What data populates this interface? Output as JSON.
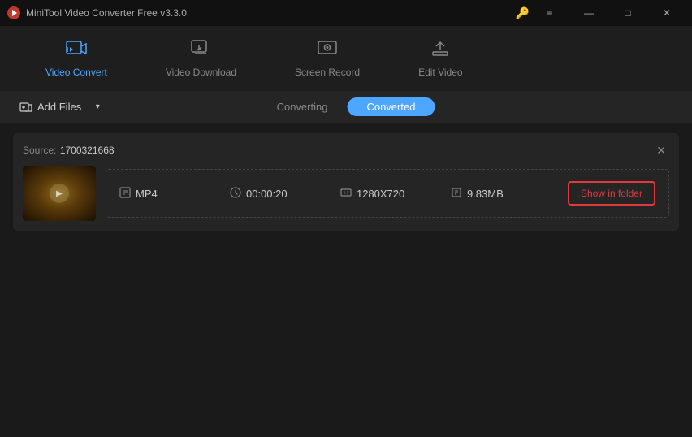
{
  "titleBar": {
    "appName": "MiniTool Video Converter Free v3.3.0",
    "keyIcon": "🔑",
    "controls": {
      "menu": "≡",
      "minimize": "—",
      "maximize": "□",
      "close": "✕"
    }
  },
  "nav": {
    "tabs": [
      {
        "id": "video-convert",
        "label": "Video Convert",
        "active": true
      },
      {
        "id": "video-download",
        "label": "Video Download",
        "active": false
      },
      {
        "id": "screen-record",
        "label": "Screen Record",
        "active": false
      },
      {
        "id": "edit-video",
        "label": "Edit Video",
        "active": false
      }
    ]
  },
  "toolbar": {
    "addFiles": "Add Files",
    "tabs": [
      {
        "id": "converting",
        "label": "Converting",
        "active": false
      },
      {
        "id": "converted",
        "label": "Converted",
        "active": true
      }
    ]
  },
  "fileCard": {
    "sourceLabel": "Source:",
    "sourceName": "1700321668",
    "format": "MP4",
    "duration": "00:00:20",
    "resolution": "1280X720",
    "size": "9.83MB",
    "showFolderBtn": "Show in folder"
  }
}
